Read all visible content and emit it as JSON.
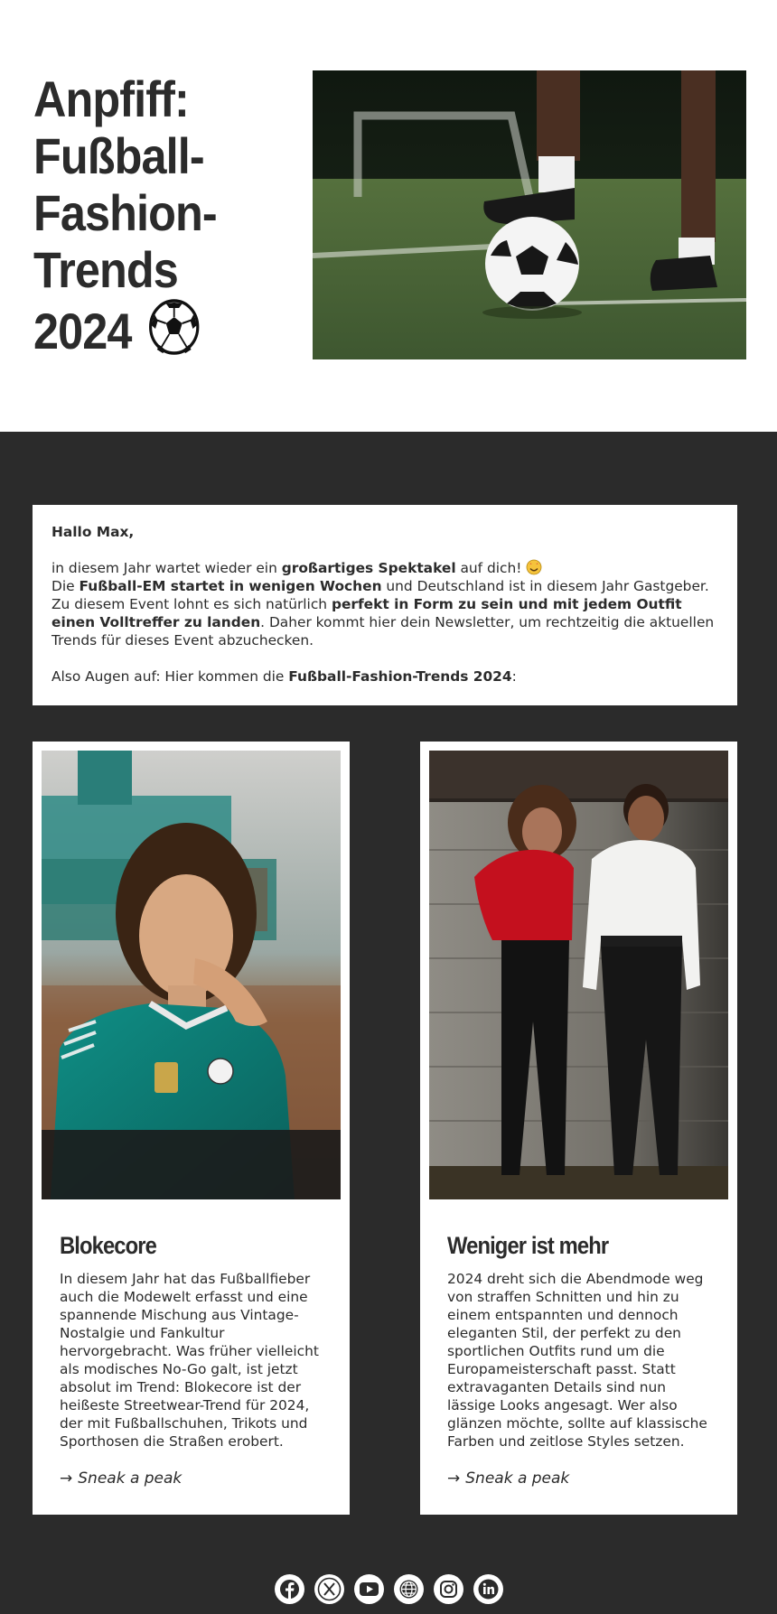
{
  "hero": {
    "title": "Anpfiff: Fußball-Fashion-Trends 2024",
    "title_icon": "soccer-ball-icon",
    "image": "football-on-grass-photo"
  },
  "intro": {
    "greeting": "Hallo Max,",
    "p1_a": "in diesem Jahr wartet wieder ein ",
    "p1_b": "großartiges Spektakel",
    "p1_c": " auf dich! ",
    "p1_icon": "star-struck-face-icon",
    "p2_a": "Die ",
    "p2_b": "Fußball-EM startet in wenigen Wochen",
    "p2_c": " und Deutschland ist in diesem Jahr Gastgeber. Zu diesem Event lohnt es sich natürlich ",
    "p2_d": "perfekt in Form zu sein und mit jedem Outfit einen Volltreffer zu landen",
    "p2_e": ". Daher kommt hier dein Newsletter, um rechtzeitig die aktuellen Trends für dieses Event abzuchecken.",
    "p3_a": "Also Augen auf: Hier kommen die ",
    "p3_b": "Fußball-Fashion-Trends 2024",
    "p3_c": ":"
  },
  "cards": [
    {
      "title": "Blokecore",
      "text": "In diesem Jahr hat das Fußballfieber auch die Modewelt erfasst und eine spannende Mischung aus Vintage-Nostalgie und Fankultur hervorgebracht. Was früher vielleicht als modisches No-Go galt, ist jetzt absolut im Trend: Blokecore ist der heißeste Streetwear-Trend für 2024, der mit Fußballschuhen, Trikots und Sporthosen die Straßen erobert.",
      "link_arrow": "→",
      "link": "Sneak a peak",
      "image": "woman-in-football-jersey-photo"
    },
    {
      "title": "Weniger ist mehr",
      "text": "2024 dreht sich die Abendmode weg von straffen Schnitten und hin zu einem entspannten und dennoch eleganten Stil, der perfekt zu den sportlichen Outfits rund um die Europameisterschaft passt. Statt extravaganten Details sind nun lässige Looks angesagt. Wer also glänzen möchte, sollte auf klassische Farben und zeitlose Styles setzen.",
      "link_arrow": "→",
      "link": "Sneak a peak",
      "image": "couple-at-wall-photo"
    }
  ],
  "social": [
    "facebook-icon",
    "x-icon",
    "youtube-icon",
    "website-icon",
    "instagram-icon",
    "linkedin-icon"
  ],
  "colors": {
    "dark_bg": "#2b2b2b",
    "card_bg": "#ffffff",
    "text": "#2b2b2b"
  }
}
